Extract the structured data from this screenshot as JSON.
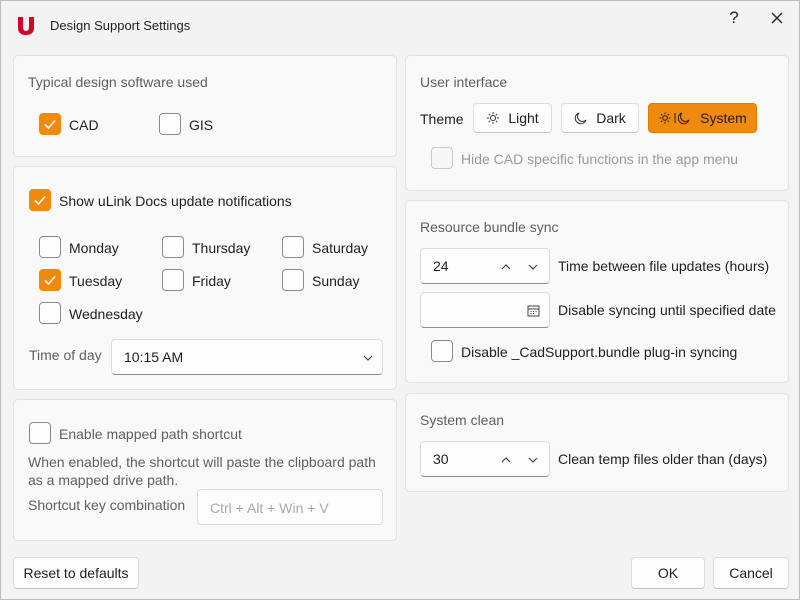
{
  "window": {
    "title": "Design Support Settings",
    "help_label": "?",
    "logo_letter": "u",
    "logo_color": "#d4002a",
    "accent_color": "#f08a0c"
  },
  "software": {
    "title": "Typical design software used",
    "options": [
      {
        "label": "CAD",
        "checked": true
      },
      {
        "label": "GIS",
        "checked": false
      }
    ]
  },
  "notifications": {
    "toggle_label": "Show uLink Docs update notifications",
    "toggle_checked": true,
    "days": [
      {
        "label": "Monday",
        "checked": false
      },
      {
        "label": "Thursday",
        "checked": false
      },
      {
        "label": "Saturday",
        "checked": false
      },
      {
        "label": "Tuesday",
        "checked": true
      },
      {
        "label": "Friday",
        "checked": false
      },
      {
        "label": "Sunday",
        "checked": false
      },
      {
        "label": "Wednesday",
        "checked": false
      }
    ],
    "time_label": "Time of day",
    "time_value": "10:15 AM"
  },
  "mapped_path": {
    "toggle_label": "Enable mapped path shortcut",
    "toggle_checked": false,
    "description_line1": "When enabled, the shortcut will paste the clipboard path",
    "description_line2": "as a mapped drive path.",
    "shortcut_label": "Shortcut key combination",
    "shortcut_placeholder": "Ctrl + Alt + Win + V"
  },
  "user_interface": {
    "title": "User interface",
    "theme_label": "Theme",
    "themes": [
      {
        "label": "Light",
        "icon": "sun-icon"
      },
      {
        "label": "Dark",
        "icon": "moon-icon"
      },
      {
        "label": "System",
        "icon": "sun-moon-icon",
        "active": true
      }
    ],
    "hide_cad_label": "Hide CAD specific functions in the app menu",
    "hide_cad_checked": false
  },
  "resource_sync": {
    "title": "Resource bundle sync",
    "hours_value": "24",
    "hours_label": "Time between file updates (hours)",
    "date_value": "",
    "date_label": "Disable syncing until specified date",
    "plugin_label": "Disable _CadSupport.bundle plug-in syncing",
    "plugin_checked": false
  },
  "system_clean": {
    "title": "System clean",
    "days_value": "30",
    "days_label": "Clean temp files older than (days)"
  },
  "footer": {
    "reset_label": "Reset to defaults",
    "ok_label": "OK",
    "cancel_label": "Cancel"
  }
}
